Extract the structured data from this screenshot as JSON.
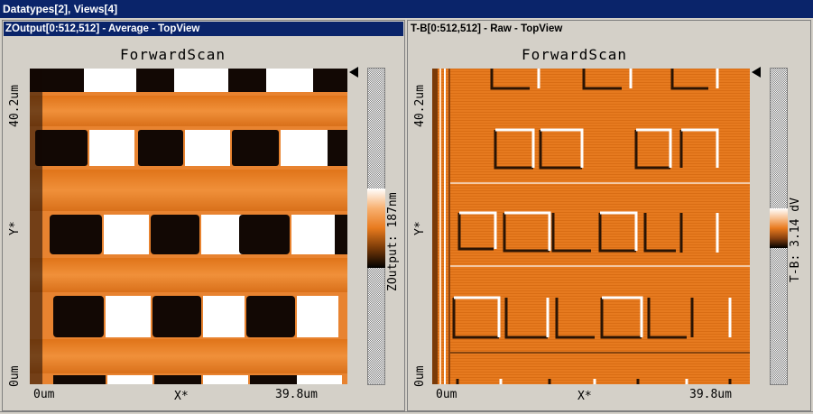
{
  "window": {
    "title": "Datatypes[2], Views[4]"
  },
  "views": [
    {
      "title": "ZOutput[0:512,512] - Average - TopView",
      "scan_label": "ForwardScan",
      "y_top_label": "40.2um",
      "y_mid_label": "Y*",
      "y_bottom_label": "0um",
      "x_left_label": "0um",
      "x_mid_label": "X*",
      "x_right_label": "39.8um",
      "colorbar_label": "ZOutput: 187nm"
    },
    {
      "title": "T-B[0:512,512] - Raw - TopView",
      "scan_label": "ForwardScan",
      "y_top_label": "40.2um",
      "y_mid_label": "Y*",
      "y_bottom_label": "0um",
      "x_left_label": "0um",
      "x_mid_label": "X*",
      "x_right_label": "39.8um",
      "colorbar_label": "T-B: 3.14 dV"
    }
  ],
  "colors": {
    "title_active": "#0a246a",
    "window_bg": "#d4d0c8",
    "afm_orange": "#e87a1e",
    "afm_dark": "#1a0d05",
    "afm_light": "#ffffff"
  }
}
